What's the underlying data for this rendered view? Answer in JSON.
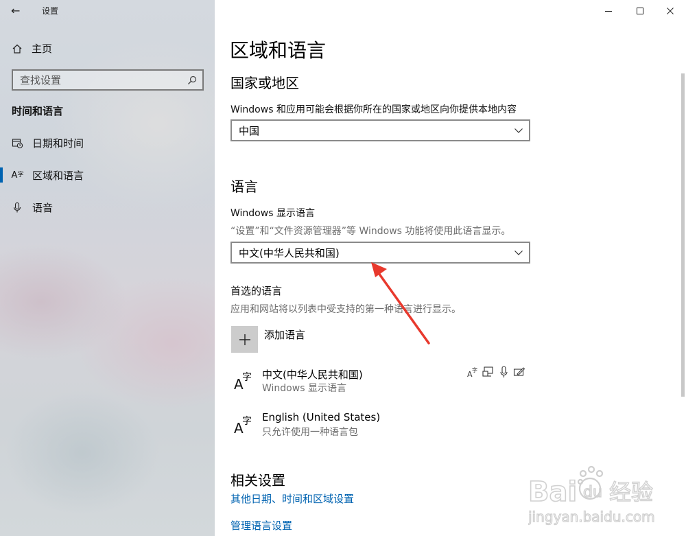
{
  "window": {
    "title": "设置",
    "back_glyph": "←",
    "controls": [
      "minimize-icon",
      "maximize-icon",
      "close-icon"
    ]
  },
  "sidebar": {
    "home_label": "主页",
    "search_placeholder": "查找设置",
    "group_label": "时间和语言",
    "items": [
      {
        "label": "日期和时间",
        "icon": "calendar-clock-icon",
        "active": false
      },
      {
        "label": "区域和语言",
        "icon": "language-icon",
        "active": true
      },
      {
        "label": "语音",
        "icon": "microphone-icon",
        "active": false
      }
    ]
  },
  "main": {
    "page_title": "区域和语言",
    "country": {
      "heading": "国家或地区",
      "description": "Windows 和应用可能会根据你所在的国家或地区向你提供本地内容",
      "selected": "中国"
    },
    "language": {
      "heading": "语言",
      "display_label": "Windows 显示语言",
      "display_desc": "“设置”和“文件资源管理器”等 Windows 功能将使用此语言显示。",
      "display_selected": "中文(中华人民共和国)",
      "preferred_label": "首选的语言",
      "preferred_desc": "应用和网站将以列表中受支持的第一种语言进行显示。",
      "add_label": "添加语言",
      "list": [
        {
          "name": "中文(中华人民共和国)",
          "sub": "Windows 显示语言",
          "features": [
            "language-pack-icon",
            "display-icon",
            "speech-icon",
            "handwriting-icon"
          ]
        },
        {
          "name": "English (United States)",
          "sub": "只允许使用一种语言包",
          "features": []
        }
      ]
    },
    "related": {
      "heading": "相关设置",
      "links": [
        "其他日期、时间和区域设置",
        "管理语言设置"
      ]
    }
  },
  "watermark": {
    "brand": "Baidu",
    "brand_cn": "经验",
    "url": "jingyan.baidu.com"
  },
  "colors": {
    "accent": "#0063b1",
    "annotation_arrow": "#e8392d"
  }
}
